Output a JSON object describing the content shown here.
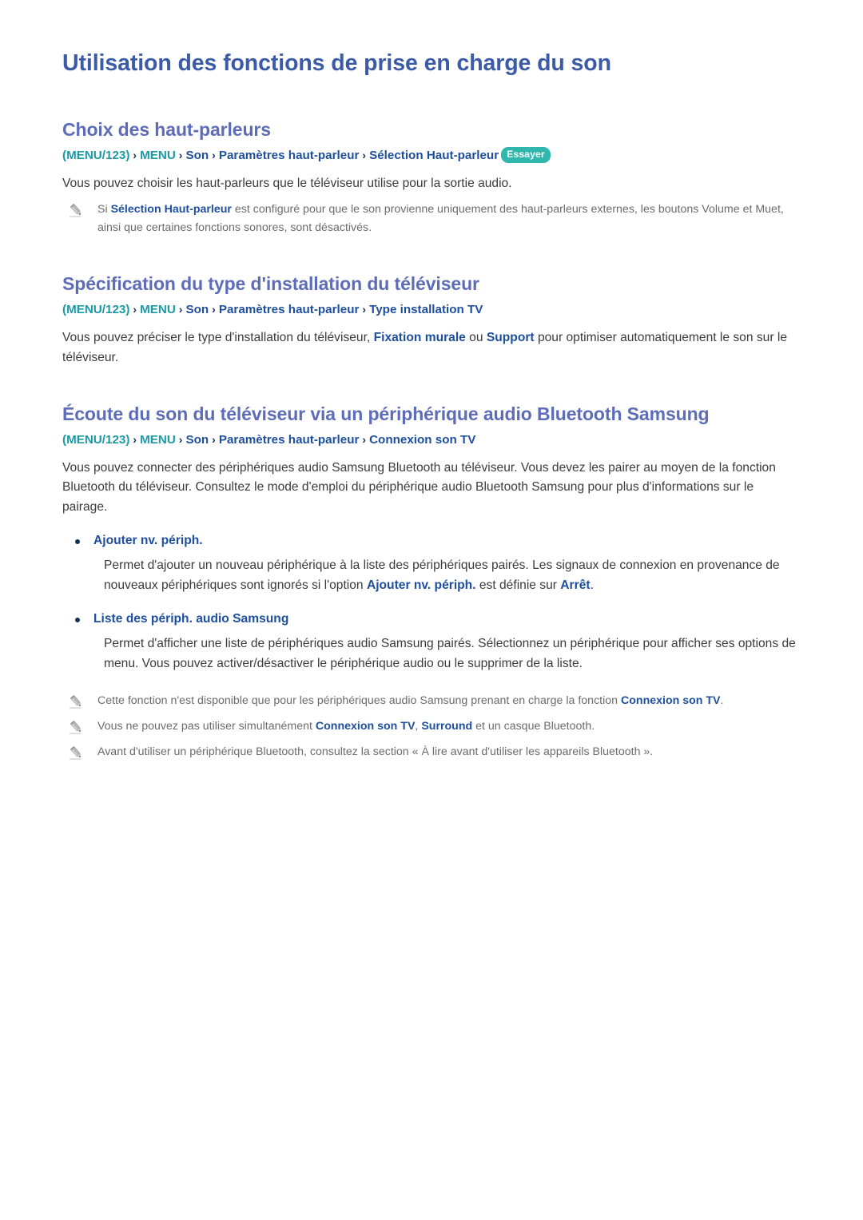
{
  "document": {
    "title": "Utilisation des fonctions de prise en charge du son",
    "colors": {
      "doc_title": "#3c5ba6",
      "section_title": "#5d6cb8",
      "breadcrumb_teal": "#1b9aa5",
      "breadcrumb_blue": "#1d4f9e",
      "breadcrumb_separator": "#13315c",
      "badge_background": "#2fb6ad",
      "badge_text": "#ffffff",
      "body_text": "#3b3b3b",
      "note_text": "#6b6b6b",
      "bullet_dot": "#13315c",
      "page_background": "#ffffff"
    }
  },
  "sections": [
    {
      "heading": "Choix des haut-parleurs",
      "breadcrumb": {
        "open_paren": "(",
        "menu123": "MENU/123",
        "close_paren": ")",
        "separator": "›",
        "menu": "MENU",
        "items": [
          "Son",
          "Paramètres haut-parleur"
        ],
        "last": "Sélection Haut-parleur",
        "badge": "Essayer"
      },
      "body": "Vous pouvez choisir les haut-parleurs que le téléviseur utilise pour la sortie audio.",
      "note": {
        "icon": "pencil-icon",
        "prefix": "Si ",
        "highlight": "Sélection Haut-parleur",
        "suffix": " est configuré pour que le son provienne uniquement des haut-parleurs externes, les boutons Volume et Muet, ainsi que certaines fonctions sonores, sont désactivés."
      }
    },
    {
      "heading": "Spécification du type d'installation du téléviseur",
      "breadcrumb": {
        "open_paren": "(",
        "menu123": "MENU/123",
        "close_paren": ")",
        "separator": "›",
        "menu": "MENU",
        "items": [
          "Son",
          "Paramètres haut-parleur"
        ],
        "last": "Type installation TV"
      },
      "body": {
        "part1": "Vous pouvez préciser le type d'installation du téléviseur, ",
        "highlight1": "Fixation murale",
        "part2": " ou ",
        "highlight2": "Support",
        "part3": " pour optimiser automatiquement le son sur le téléviseur."
      }
    },
    {
      "heading": "Écoute du son du téléviseur via un périphérique audio Bluetooth Samsung",
      "breadcrumb": {
        "open_paren": "(",
        "menu123": "MENU/123",
        "close_paren": ")",
        "separator": "›",
        "menu": "MENU",
        "items": [
          "Son",
          "Paramètres haut-parleur"
        ],
        "last": "Connexion son TV"
      },
      "body": "Vous pouvez connecter des périphériques audio Samsung Bluetooth au téléviseur. Vous devez les pairer au moyen de la fonction Bluetooth du téléviseur. Consultez le mode d'emploi du périphérique audio Bluetooth Samsung pour plus d'informations sur le pairage.",
      "bullets": [
        {
          "label": "Ajouter nv. périph.",
          "desc_part1": "Permet d'ajouter un nouveau périphérique à la liste des périphériques pairés. Les signaux de connexion en provenance de nouveaux périphériques sont ignorés si l'option ",
          "desc_highlight1": "Ajouter nv. périph.",
          "desc_part2": " est définie sur ",
          "desc_highlight2": "Arrêt",
          "desc_part3": "."
        },
        {
          "label": "Liste des périph. audio Samsung",
          "desc_part1": "Permet d'afficher une liste de périphériques audio Samsung pairés. Sélectionnez un périphérique pour afficher ses options de menu. Vous pouvez activer/désactiver le périphérique audio ou le supprimer de la liste.",
          "desc_highlight1": "",
          "desc_part2": "",
          "desc_highlight2": "",
          "desc_part3": ""
        }
      ],
      "notes": [
        {
          "icon": "pencil-icon",
          "prefix": "Cette fonction n'est disponible que pour les périphériques audio Samsung prenant en charge la fonction ",
          "highlight": "Connexion son TV",
          "suffix": "."
        },
        {
          "icon": "pencil-icon",
          "prefix": "Vous ne pouvez pas utiliser simultanément ",
          "highlight": "Connexion son TV",
          "middle": ", ",
          "highlight2": "Surround",
          "suffix": " et un casque Bluetooth."
        },
        {
          "icon": "pencil-icon",
          "prefix": "Avant d'utiliser un périphérique Bluetooth, consultez la section « À lire avant d'utiliser les appareils Bluetooth ».",
          "highlight": "",
          "suffix": ""
        }
      ]
    }
  ]
}
